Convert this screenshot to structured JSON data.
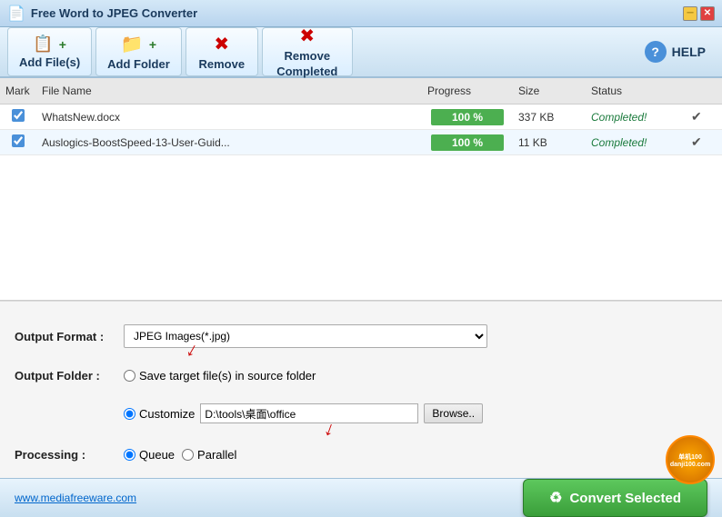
{
  "titleBar": {
    "title": "Free Word to JPEG Converter",
    "icon": "📄"
  },
  "toolbar": {
    "addFiles": "Add File(s)",
    "addFolder": "Add Folder",
    "remove": "Remove",
    "removeCompleted": "Remove\nCompleted",
    "help": "HELP"
  },
  "fileList": {
    "headers": [
      "Mark",
      "File Name",
      "Progress",
      "Size",
      "Status",
      ""
    ],
    "rows": [
      {
        "mark": true,
        "filename": "WhatsNew.docx",
        "progress": "100 %",
        "size": "337 KB",
        "status": "Completed!",
        "done": "✔"
      },
      {
        "mark": true,
        "filename": "Auslogics-BoostSpeed-13-User-Guid...",
        "progress": "100 %",
        "size": "11 KB",
        "status": "Completed!",
        "done": "✔"
      }
    ]
  },
  "settings": {
    "outputFormatLabel": "Output Format :",
    "outputFormatValue": "JPEG Images(*.jpg)",
    "outputFolderLabel": "Output Folder :",
    "saveInSourceLabel": "Save target file(s) in source folder",
    "customizeLabel": "Customize",
    "customizePath": "D:\\tools\\桌面\\office",
    "browseLabel": "Browse..",
    "processingLabel": "Processing :",
    "queueLabel": "Queue",
    "parallelLabel": "Parallel"
  },
  "bottomBar": {
    "websiteUrl": "www.mediafreeware.com",
    "convertLabel": "Convert Selected"
  },
  "colors": {
    "accent": "#4a90d9",
    "progressGreen": "#4caf50",
    "convertGreen": "#3a9e3a",
    "toolbarBg": "#d8edf8"
  }
}
